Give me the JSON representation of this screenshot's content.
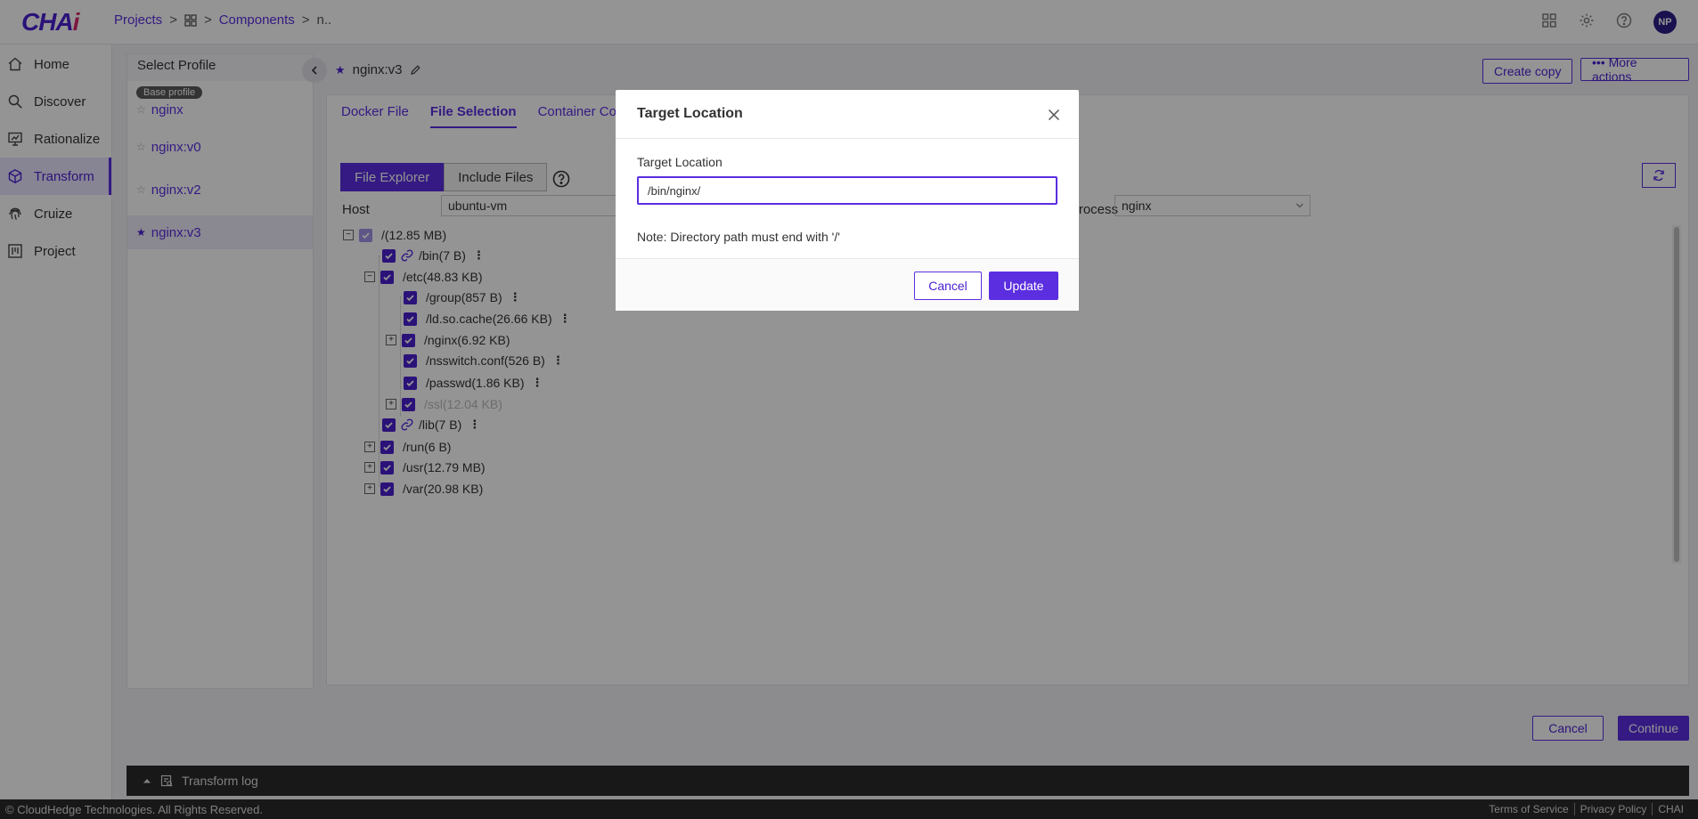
{
  "app": {
    "logo_main": "CHA",
    "logo_accent": "i"
  },
  "breadcrumb": {
    "projects": "Projects",
    "components": "Components",
    "current": "n.."
  },
  "header": {
    "avatar_initials": "NP"
  },
  "nav": {
    "items": [
      {
        "label": "Home",
        "icon": "home-icon"
      },
      {
        "label": "Discover",
        "icon": "search-icon"
      },
      {
        "label": "Rationalize",
        "icon": "presentation-icon"
      },
      {
        "label": "Transform",
        "icon": "cube-icon",
        "active": true
      },
      {
        "label": "Cruize",
        "icon": "fingerprint-icon"
      },
      {
        "label": "Project",
        "icon": "board-icon"
      }
    ]
  },
  "profiles": {
    "title": "Select Profile",
    "base_badge": "Base profile",
    "items": [
      {
        "label": "nginx",
        "active": false
      },
      {
        "label": "nginx:v0",
        "active": false
      },
      {
        "label": "nginx:v2",
        "active": false
      },
      {
        "label": "nginx:v3",
        "active": true
      }
    ]
  },
  "main": {
    "title": "nginx:v3",
    "create_copy": "Create copy",
    "more_actions": "••• More actions",
    "tabs": [
      "Docker File",
      "File Selection",
      "Container Cor"
    ],
    "explorer_tabs": {
      "file_explorer": "File Explorer",
      "include_files": "Include Files"
    },
    "host_label": "Host",
    "host_value": "ubuntu-vm",
    "process_label": "Process",
    "process_value": "nginx"
  },
  "tree": [
    {
      "name": "/(12.85 MB)"
    },
    {
      "name": "/bin(7 B)"
    },
    {
      "name": "/etc(48.83 KB)"
    },
    {
      "name": "/group(857 B)"
    },
    {
      "name": "/ld.so.cache(26.66 KB)"
    },
    {
      "name": "/nginx(6.92 KB)"
    },
    {
      "name": "/nsswitch.conf(526 B)"
    },
    {
      "name": "/passwd(1.86 KB)"
    },
    {
      "name": "/ssl(12.04 KB)"
    },
    {
      "name": "/lib(7 B)"
    },
    {
      "name": "/run(6 B)"
    },
    {
      "name": "/usr(12.79 MB)"
    },
    {
      "name": "/var(20.98 KB)"
    }
  ],
  "bottom": {
    "cancel": "Cancel",
    "continue": "Continue",
    "log": "Transform log"
  },
  "footer": {
    "copyright": "© CloudHedge Technologies. All Rights Reserved.",
    "links": [
      "Terms of Service",
      "Privacy Policy",
      "CHAI"
    ]
  },
  "modal": {
    "title": "Target Location",
    "field_label": "Target Location",
    "field_value": "/bin/nginx/",
    "note": "Note: Directory path must end with '/'",
    "cancel": "Cancel",
    "update": "Update"
  },
  "colors": {
    "accent": "#5b2ee0",
    "accent_dark": "#4a1fd1",
    "logo_accent": "#d4286e"
  }
}
